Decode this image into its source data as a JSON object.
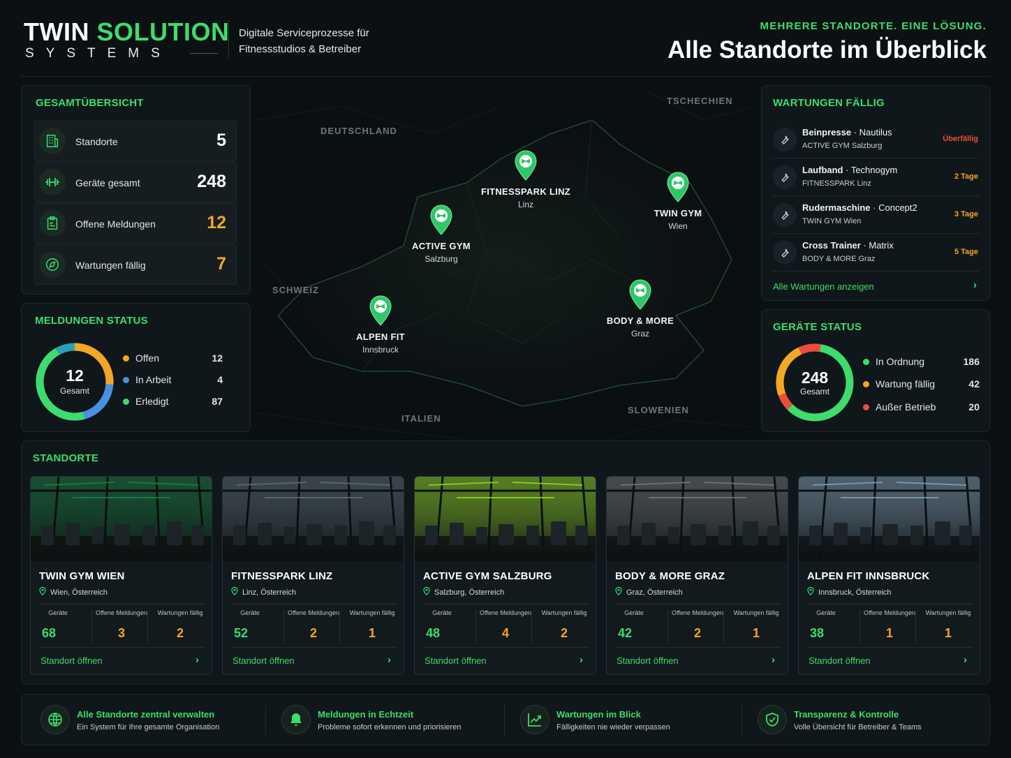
{
  "header": {
    "logo_main_white": "TWIN",
    "logo_main_green": "SOLUTION",
    "logo_sub": "SYSTEMS",
    "tagline_line1": "Digitale Serviceprozesse für",
    "tagline_line2": "Fitnessstudios & Betreiber",
    "kicker": "MEHRERE STANDORTE. EINE LÖSUNG.",
    "title": "Alle Standorte im Überblick"
  },
  "overview": {
    "title": "GESAMTÜBERSICHT",
    "rows": [
      {
        "icon": "building-icon",
        "label": "Standorte",
        "value": "5",
        "color": "#ffffff"
      },
      {
        "icon": "dumbbell-icon",
        "label": "Geräte gesamt",
        "value": "248",
        "color": "#ffffff"
      },
      {
        "icon": "clipboard-icon",
        "label": "Offene Meldungen",
        "value": "12",
        "color": "#f5a623"
      },
      {
        "icon": "compass-icon",
        "label": "Wartungen fällig",
        "value": "7",
        "color": "#f5a623"
      }
    ]
  },
  "reports_status": {
    "title": "MELDUNGEN STATUS",
    "center_value": "12",
    "center_label": "Gesamt",
    "legend": [
      {
        "label": "Offen",
        "value": "12",
        "color": "#f5a623"
      },
      {
        "label": "In Arbeit",
        "value": "4",
        "color": "#4a90e2"
      },
      {
        "label": "Erledigt",
        "value": "87",
        "color": "#3ddc6e"
      }
    ]
  },
  "map": {
    "countries": [
      "DEUTSCHLAND",
      "TSCHECHIEN",
      "SCHWEIZ",
      "ITALIEN",
      "SLOWENIEN"
    ],
    "pins": [
      {
        "name": "FITNESSPARK LINZ",
        "city": "Linz"
      },
      {
        "name": "TWIN GYM",
        "city": "Wien"
      },
      {
        "name": "ACTIVE GYM",
        "city": "Salzburg"
      },
      {
        "name": "BODY & MORE",
        "city": "Graz"
      },
      {
        "name": "ALPEN FIT",
        "city": "Innsbruck"
      }
    ]
  },
  "maintenance": {
    "title": "WARTUNGEN FÄLLIG",
    "items": [
      {
        "device": "Beinpresse",
        "brand": " · Nautilus",
        "location": "ACTIVE GYM Salzburg",
        "badge": "Überfällig",
        "badge_color": "#ef4b3f"
      },
      {
        "device": "Laufband",
        "brand": " · Technogym",
        "location": "FITNESSPARK Linz",
        "badge": "2 Tage",
        "badge_color": "#f5a623"
      },
      {
        "device": "Rudermaschine",
        "brand": " · Concept2",
        "location": "TWIN GYM Wien",
        "badge": "3 Tage",
        "badge_color": "#f5a623"
      },
      {
        "device": "Cross Trainer",
        "brand": " · Matrix",
        "location": "BODY & MORE Graz",
        "badge": "5 Tage",
        "badge_color": "#f5a623"
      }
    ],
    "link": "Alle Wartungen anzeigen"
  },
  "devices_status": {
    "title": "GERÄTE STATUS",
    "center_value": "248",
    "center_label": "Gesamt",
    "legend": [
      {
        "label": "In Ordnung",
        "value": "186",
        "color": "#3ddc6e"
      },
      {
        "label": "Wartung fällig",
        "value": "42",
        "color": "#f5a623"
      },
      {
        "label": "Außer Betrieb",
        "value": "20",
        "color": "#ef4b3f"
      }
    ]
  },
  "locations": {
    "title": "STANDORTE",
    "stat_labels": {
      "devices": "Geräte",
      "reports": "Offene Meldungen",
      "maint": "Wartungen fällig"
    },
    "open_label": "Standort öffnen",
    "cards": [
      {
        "name": "TWIN GYM WIEN",
        "place": "Wien, Österreich",
        "devices": "68",
        "reports": "3",
        "maint": "2",
        "theme": "#1f7a45"
      },
      {
        "name": "FITNESSPARK LINZ",
        "place": "Linz, Österreich",
        "devices": "52",
        "reports": "2",
        "maint": "1",
        "theme": "#5b6a74"
      },
      {
        "name": "ACTIVE GYM SALZBURG",
        "place": "Salzburg, Österreich",
        "devices": "48",
        "reports": "4",
        "maint": "2",
        "theme": "#8ccf2a"
      },
      {
        "name": "BODY & MORE GRAZ",
        "place": "Graz, Österreich",
        "devices": "42",
        "reports": "2",
        "maint": "1",
        "theme": "#6e7478"
      },
      {
        "name": "ALPEN FIT INNSBRUCK",
        "place": "Innsbruck, Österreich",
        "devices": "38",
        "reports": "1",
        "maint": "1",
        "theme": "#7f9bb0"
      }
    ]
  },
  "features": [
    {
      "icon": "globe-icon",
      "title": "Alle Standorte zentral verwalten",
      "sub": "Ein System für Ihre gesamte Organisation"
    },
    {
      "icon": "bell-icon",
      "title": "Meldungen in Echtzeit",
      "sub": "Probleme sofort erkennen und priorisieren"
    },
    {
      "icon": "trend-chart-icon",
      "title": "Wartungen im Blick",
      "sub": "Fälligkeiten nie wieder verpassen"
    },
    {
      "icon": "shield-check-icon",
      "title": "Transparenz & Kontrolle",
      "sub": "Volle Übersicht für Betreiber & Teams"
    }
  ]
}
